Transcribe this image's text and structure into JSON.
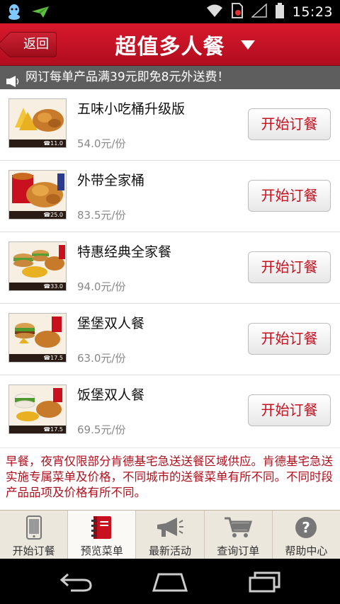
{
  "status_bar": {
    "time": "15:23",
    "icons": [
      "qq-icon",
      "paper-plane-icon",
      "wifi-icon",
      "no-sim-icon",
      "signal-icon",
      "battery-icon"
    ]
  },
  "header": {
    "back_label": "返回",
    "title": "超值多人餐",
    "dropdown_icon": "triangle-down-icon"
  },
  "notice": {
    "text": "网订每单产品满39元即免8元外送费！",
    "icon": "speaker-icon"
  },
  "items": [
    {
      "name": "五味小吃桶升级版",
      "price": "54.0元/份",
      "tag": "☎11.0",
      "button": "开始订餐"
    },
    {
      "name": "外带全家桶",
      "price": "83.5元/份",
      "tag": "☎25.0",
      "button": "开始订餐"
    },
    {
      "name": "特惠经典全家餐",
      "price": "94.0元/份",
      "tag": "☎33.0",
      "button": "开始订餐"
    },
    {
      "name": "堡堡双人餐",
      "price": "63.0元/份",
      "tag": "☎17.5",
      "button": "开始订餐"
    },
    {
      "name": "饭堡双人餐",
      "price": "69.5元/份",
      "tag": "☎17.5",
      "button": "开始订餐"
    }
  ],
  "info_text": "早餐，夜宵仅限部分肯德基宅急送送餐区域供应。肯德基宅急送实施专属菜单及价格，不同城市的送餐菜单有所不同。不同时段产品品项及价格有所不同。",
  "tabs": [
    {
      "label": "开始订餐",
      "icon": "phone-icon"
    },
    {
      "label": "预览菜单",
      "icon": "menu-book-icon"
    },
    {
      "label": "最新活动",
      "icon": "megaphone-icon"
    },
    {
      "label": "查询订单",
      "icon": "cart-icon"
    },
    {
      "label": "帮助中心",
      "icon": "help-icon"
    }
  ],
  "active_tab": "预览菜单",
  "colors": {
    "brand_red": "#c8101e",
    "header_red": "#d8182c",
    "tab_bg": "#ece7dd"
  }
}
